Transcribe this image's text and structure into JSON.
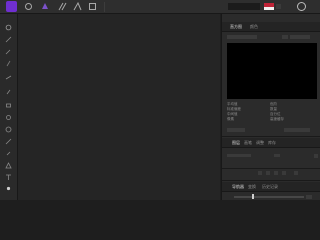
{
  "app": {
    "accent_color": "#6f2fd0",
    "logo_icon": "affinity-logo"
  },
  "toolbar": {
    "icons": [
      "persona-photo-icon",
      "persona-liquify-icon",
      "persona-develop-icon",
      "persona-tone-map-icon",
      "persona-export-icon"
    ],
    "right_icons": [
      "flag-icon",
      "avatar-icon"
    ]
  },
  "left_tools": [
    "move-tool-icon",
    "view-tool-icon",
    "crop-tool-icon",
    "selection-brush-icon",
    "flood-select-icon",
    "paint-brush-icon",
    "erase-brush-icon",
    "dodge-brush-icon",
    "clone-brush-icon",
    "healing-brush-icon",
    "red-eye-icon",
    "pen-tool-icon",
    "shape-tool-icon",
    "text-tool-icon",
    "color-picker-icon"
  ],
  "navigator": {
    "tabs": [
      "直方图",
      "颜色"
    ],
    "info_labels_left": [
      "平均值",
      "标准偏差",
      "中间值",
      "像素"
    ],
    "info_labels_right": [
      "色阶",
      "数量",
      "百分位",
      "高速缓存"
    ]
  },
  "layers": {
    "tabs": [
      "图层",
      "画笔",
      "调整",
      "库存"
    ]
  },
  "history": {
    "tabs": [
      "导航器",
      "变换",
      "历史记录"
    ]
  }
}
